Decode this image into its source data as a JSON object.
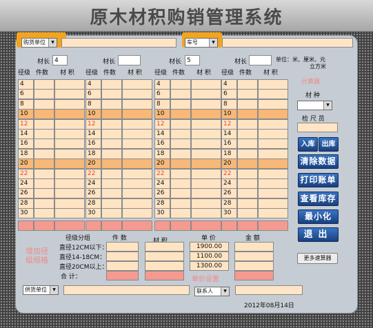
{
  "app_title": "原木材积购销管理系统",
  "top": {
    "buyer_select": "购货单位",
    "plate_select": "车号",
    "unit_note_line1": "单位：米、厘米、元",
    "unit_note_line2": "立方米"
  },
  "tables": [
    {
      "length_label": "材长",
      "length_value": "4"
    },
    {
      "length_label": "材长",
      "length_value": ""
    },
    {
      "length_label": "材长",
      "length_value": "5"
    },
    {
      "length_label": "材长",
      "length_value": ""
    }
  ],
  "col_headers": {
    "diameter": "径级",
    "count": "件数",
    "volume": "材 积"
  },
  "diameters": [
    "4",
    "6",
    "8",
    "10",
    "12",
    "14",
    "16",
    "18",
    "20",
    "22",
    "24",
    "26",
    "28",
    "30"
  ],
  "highlight_diameters": [
    "10",
    "20"
  ],
  "red_diameters": [
    "12",
    "22"
  ],
  "side": {
    "calculator_link": "计算器",
    "species_label": "材 种",
    "inspector_label": "检 尺 员",
    "buttons": [
      "入库",
      "出库",
      "清除数据",
      "打印账单",
      "查看库存",
      "最小化",
      "退出"
    ],
    "more_calculator": "更多速算器"
  },
  "summary": {
    "group_header": "径级分组",
    "count_header": "件 数",
    "volume_header": "材 积",
    "price_header": "单 价",
    "amount_header": "金 额",
    "rows": [
      {
        "label": "直径12CM以下：",
        "price": "1900.00"
      },
      {
        "label": "直径14-18CM：",
        "price": "1100.00"
      },
      {
        "label": "直径20CM以上：",
        "price": "1300.00"
      }
    ],
    "total_label": "合  计：",
    "add_group_line1": "增加径",
    "add_group_line2": "级规格",
    "price_settings": "单价设置"
  },
  "bottom": {
    "supplier_select": "供货单位",
    "contact_select": "联系人",
    "date": "2012年08月14日"
  }
}
